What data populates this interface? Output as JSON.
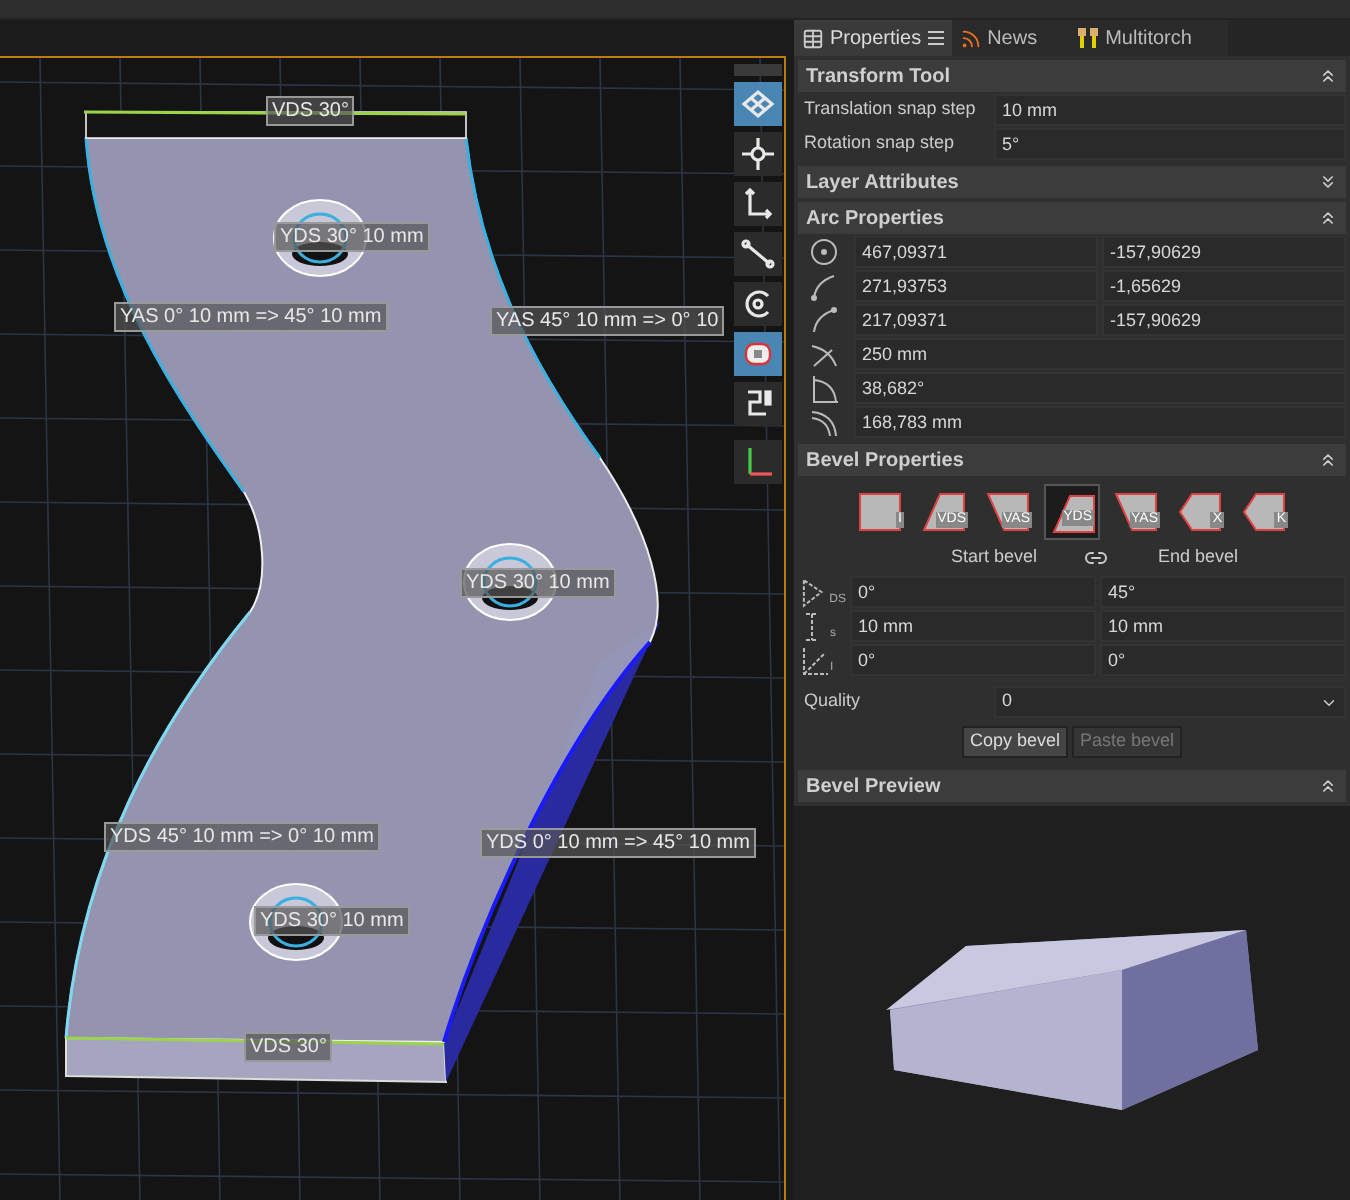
{
  "viewport": {
    "labels": [
      {
        "text": "VDS 30°"
      },
      {
        "text": "YDS 30° 10 mm"
      },
      {
        "text": "YAS 0° 10 mm => 45° 10 mm"
      },
      {
        "text": "YAS 45° 10 mm => 0° 10"
      },
      {
        "text": "YDS 30° 10 mm"
      },
      {
        "text": "YDS 45° 10 mm => 0° 10 mm"
      },
      {
        "text": "YDS 0° 10 mm => 45° 10 mm"
      },
      {
        "text": "YDS 30° 10 mm"
      },
      {
        "text": "VDS 30°"
      }
    ],
    "toolbar": [
      {
        "kind": "grid",
        "selected": true
      },
      {
        "kind": "crosshair",
        "selected": false
      },
      {
        "kind": "axes",
        "selected": false
      },
      {
        "kind": "line",
        "selected": false
      },
      {
        "kind": "arc",
        "selected": false
      },
      {
        "kind": "bevel",
        "selected": true
      },
      {
        "kind": "path",
        "selected": false
      },
      {
        "kind": "origin",
        "selected": false
      }
    ]
  },
  "panel": {
    "tabs": [
      {
        "kind": "properties",
        "label": "Properties",
        "selected": true
      },
      {
        "kind": "news",
        "label": "News",
        "selected": false
      },
      {
        "kind": "torch",
        "label": "Multitorch",
        "selected": false
      }
    ],
    "transform_tool": {
      "title": "Transform Tool",
      "expanded": true,
      "rows": [
        {
          "label": "Translation snap step",
          "value": "10 mm"
        },
        {
          "label": "Rotation snap step",
          "value": "5°"
        }
      ]
    },
    "layer_attributes": {
      "title": "Layer Attributes",
      "expanded": false
    },
    "arc_properties": {
      "title": "Arc Properties",
      "expanded": true,
      "rows": [
        {
          "kind": "center",
          "values": [
            "467,09371",
            "-157,90629"
          ]
        },
        {
          "kind": "start",
          "values": [
            "271,93753",
            "-1,65629"
          ]
        },
        {
          "kind": "end",
          "values": [
            "217,09371",
            "-157,90629"
          ]
        },
        {
          "kind": "radius",
          "values": [
            "250 mm"
          ]
        },
        {
          "kind": "angle",
          "values": [
            "38,682°"
          ]
        },
        {
          "kind": "length",
          "values": [
            "168,783 mm"
          ]
        }
      ]
    },
    "bevel_properties": {
      "title": "Bevel Properties",
      "expanded": true,
      "bevel_types": [
        {
          "kind": "straight",
          "label": "I",
          "selected": false
        },
        {
          "kind": "forward",
          "label": "VDS",
          "selected": false
        },
        {
          "kind": "backward",
          "label": "VAS",
          "selected": false
        },
        {
          "kind": "forward",
          "label": "YDS",
          "selected": true
        },
        {
          "kind": "backward",
          "label": "YAS",
          "selected": false
        },
        {
          "kind": "double",
          "label": "X",
          "selected": false
        },
        {
          "kind": "double",
          "label": "K",
          "selected": false
        }
      ],
      "start_label": "Start bevel",
      "end_label": "End bevel",
      "rows": [
        {
          "kind": "angle",
          "subscript": "DS",
          "start": "0°",
          "end": "45°"
        },
        {
          "kind": "height",
          "subscript": "s",
          "start": "10 mm",
          "end": "10 mm"
        },
        {
          "kind": "tilt",
          "subscript": "I",
          "start": "0°",
          "end": "0°"
        }
      ],
      "quality": {
        "label": "Quality",
        "value": "0"
      },
      "buttons": [
        {
          "label": "Copy bevel",
          "disabled": false
        },
        {
          "label": "Paste bevel",
          "disabled": true
        }
      ]
    },
    "bevel_preview": {
      "title": "Bevel Preview",
      "expanded": true
    }
  }
}
